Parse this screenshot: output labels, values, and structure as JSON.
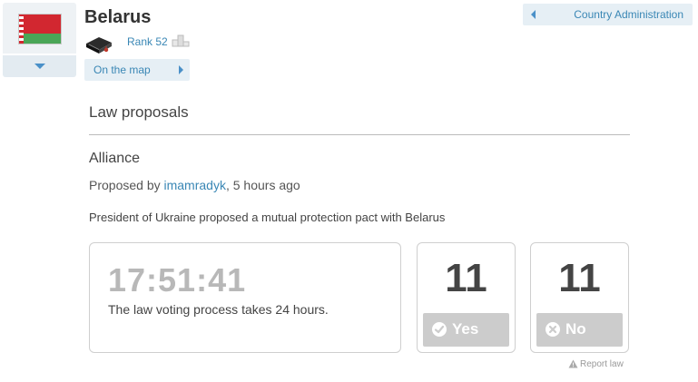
{
  "country": {
    "name": "Belarus",
    "rank_label": "Rank 52",
    "on_map_label": "On the map"
  },
  "admin": {
    "label": "Country Administration"
  },
  "section": {
    "title": "Law proposals"
  },
  "law": {
    "title": "Alliance",
    "proposed_prefix": "Proposed by",
    "proposer": "imamradyk",
    "time_ago": ", 5 hours ago",
    "description": "President of Ukraine proposed a mutual protection pact with Belarus",
    "timer": "17:51:41",
    "timer_note": "The law voting process takes 24 hours.",
    "yes_count": "11",
    "yes_label": "Yes",
    "no_count": "11",
    "no_label": "No",
    "report_label": "Report law"
  },
  "colors": {
    "link": "#3a87b5",
    "flag_red": "#d22730",
    "flag_green": "#4aa657",
    "vote_button": "#cccccc"
  },
  "icons": [
    "chevron-down-icon",
    "book-icon",
    "podium-icon",
    "arrow-right-icon",
    "arrow-left-icon",
    "check-icon",
    "cross-icon",
    "warning-icon"
  ]
}
